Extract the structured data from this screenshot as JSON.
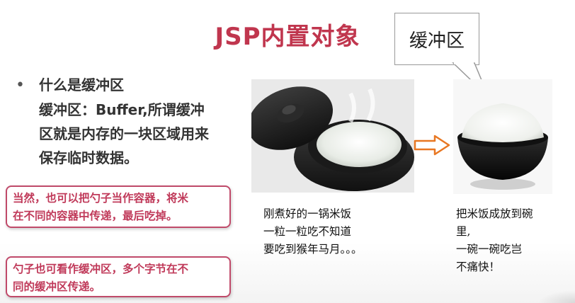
{
  "slide": {
    "title": "JSP内置对象",
    "callout": "缓冲区",
    "bullet": {
      "heading": "什么是缓冲区",
      "lines": [
        "缓冲区：Buffer,所谓缓冲",
        "区就是内存的一块区域用来",
        "保存临时数据。"
      ]
    },
    "notes": [
      {
        "lines": [
          "当然，也可以把勺子当作容器，将米",
          "在不同的容器中传递，最后吃掉。"
        ]
      },
      {
        "lines": [
          "勺子也可看作缓冲区，多个字节在不",
          "同的缓冲区传递。"
        ]
      }
    ],
    "pot_caption": [
      "刚煮好的一锅米饭",
      "一粒一粒吃不知道",
      "要吃到猴年马月。。。"
    ],
    "bowl_caption": [
      "把米饭成放到碗",
      "里,",
      "一碗一碗吃岂",
      "不痛快！"
    ]
  },
  "colors": {
    "title": "#c0364e",
    "note_border": "#c04a6a",
    "note_text": "#c03a5a",
    "arrow": "#e87722"
  },
  "icons": [
    "bullet-dot",
    "right-arrow-icon"
  ]
}
